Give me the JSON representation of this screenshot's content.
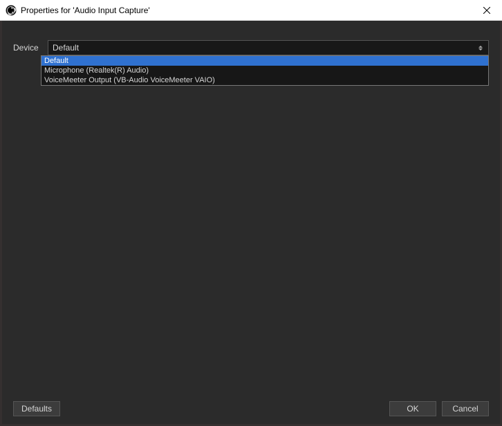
{
  "titlebar": {
    "title": "Properties for 'Audio Input Capture'"
  },
  "form": {
    "device_label": "Device",
    "device_value": "Default"
  },
  "dropdown": {
    "options": [
      "Default",
      "Microphone (Realtek(R) Audio)",
      "VoiceMeeter Output (VB-Audio VoiceMeeter VAIO)"
    ]
  },
  "buttons": {
    "defaults": "Defaults",
    "ok": "OK",
    "cancel": "Cancel"
  }
}
